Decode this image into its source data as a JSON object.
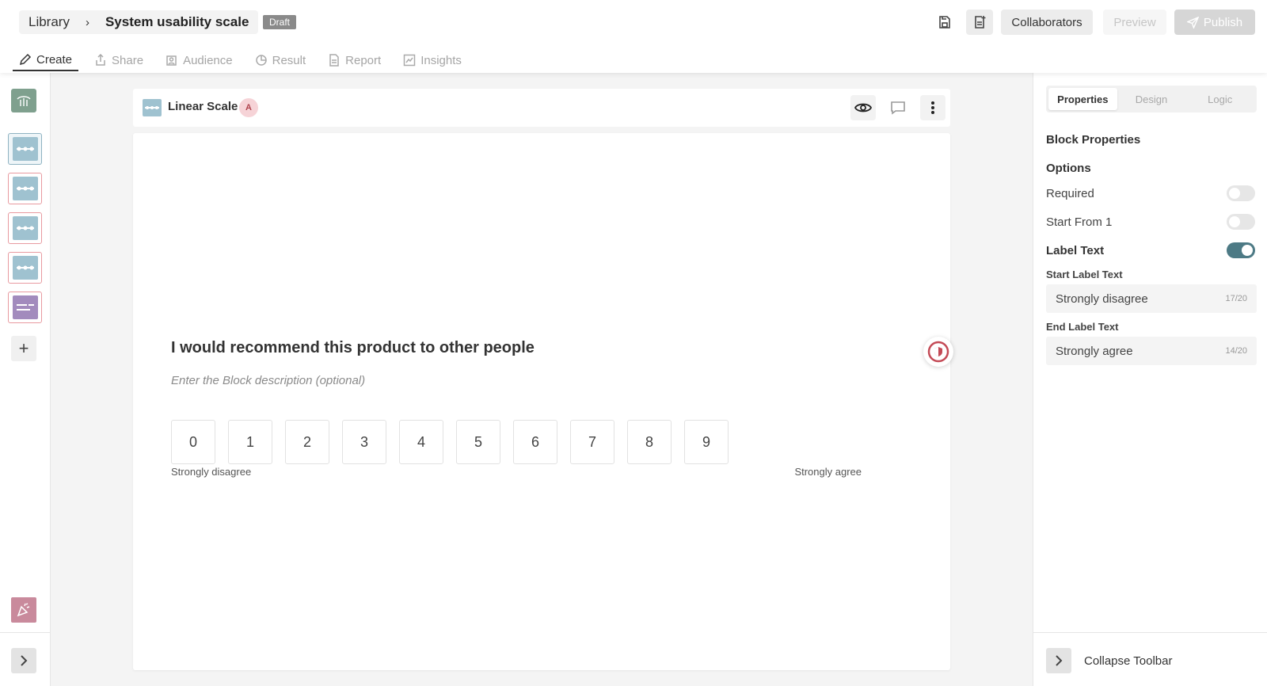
{
  "header": {
    "breadcrumb_root": "Library",
    "breadcrumb_separator": "›",
    "survey_title": "System usability scale",
    "status_badge": "Draft",
    "icons": [
      "save-icon",
      "add-page-icon"
    ],
    "collaborators_label": "Collaborators",
    "preview_label": "Preview",
    "publish_label": "Publish"
  },
  "tabs": [
    {
      "label": "Create",
      "icon": "pencil-icon",
      "active": true
    },
    {
      "label": "Share",
      "icon": "share-icon",
      "active": false
    },
    {
      "label": "Audience",
      "icon": "audience-icon",
      "active": false
    },
    {
      "label": "Result",
      "icon": "pie-chart-icon",
      "active": false
    },
    {
      "label": "Report",
      "icon": "report-icon",
      "active": false
    },
    {
      "label": "Insights",
      "icon": "line-chart-icon",
      "active": false
    }
  ],
  "left_rail": {
    "add_label": "+",
    "blocks": [
      {
        "type": "linear-scale",
        "selected": true
      },
      {
        "type": "linear-scale",
        "selected": false
      },
      {
        "type": "linear-scale",
        "selected": false
      },
      {
        "type": "linear-scale",
        "selected": false
      },
      {
        "type": "text",
        "selected": false
      }
    ]
  },
  "block": {
    "type_label": "Linear Scale",
    "avatar_initial": "A",
    "question": "I would recommend this product to other people",
    "description_placeholder": "Enter the Block description (optional)",
    "scale": [
      "0",
      "1",
      "2",
      "3",
      "4",
      "5",
      "6",
      "7",
      "8",
      "9"
    ],
    "start_label": "Strongly disagree",
    "end_label": "Strongly agree"
  },
  "right_panel": {
    "tabs": [
      {
        "label": "Properties",
        "active": true
      },
      {
        "label": "Design",
        "active": false
      },
      {
        "label": "Logic",
        "active": false
      }
    ],
    "section_title": "Block Properties",
    "options_title": "Options",
    "options": [
      {
        "label": "Required",
        "on": false
      },
      {
        "label": "Start From 1",
        "on": false
      },
      {
        "label": "Label Text",
        "on": true
      }
    ],
    "start_label_title": "Start Label Text",
    "start_label_value": "Strongly disagree",
    "start_label_count": "17/20",
    "end_label_title": "End Label Text",
    "end_label_value": "Strongly agree",
    "end_label_count": "14/20",
    "collapse_label": "Collapse Toolbar"
  },
  "colors": {
    "accent": "#4d7a85",
    "block_icon": "#9fc2d0",
    "rail_border": "#e89aa0",
    "text_block": "#a28bbd"
  }
}
